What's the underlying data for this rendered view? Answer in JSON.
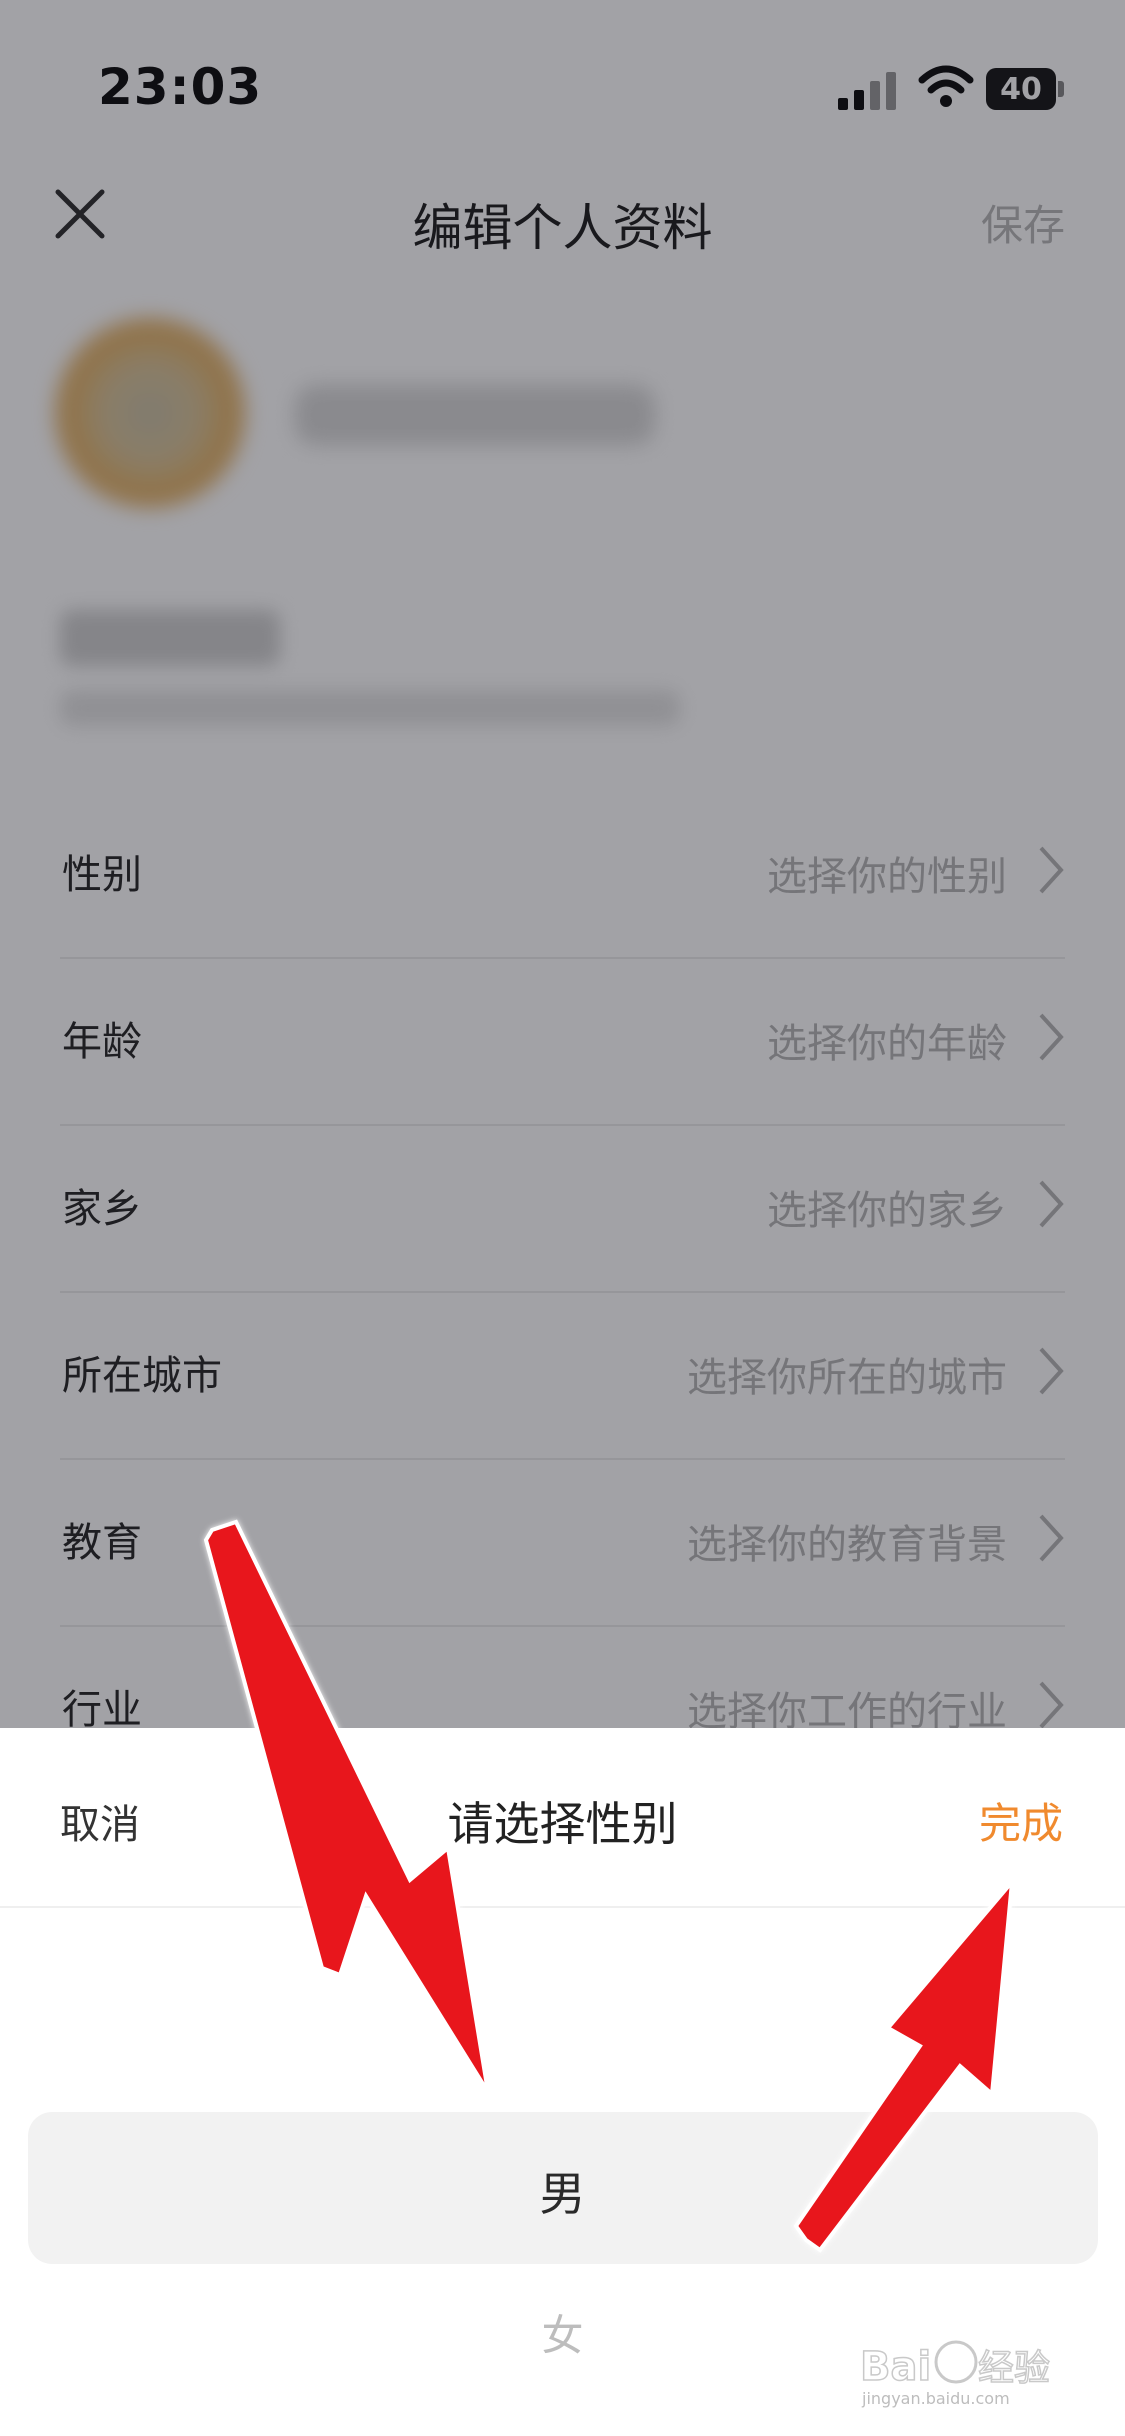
{
  "status_bar": {
    "time": "23:03",
    "battery": "40"
  },
  "nav": {
    "title": "编辑个人资料",
    "save_label": "保存"
  },
  "fields": [
    {
      "label": "性别",
      "value": "选择你的性别"
    },
    {
      "label": "年龄",
      "value": "选择你的年龄"
    },
    {
      "label": "家乡",
      "value": "选择你的家乡"
    },
    {
      "label": "所在城市",
      "value": "选择你所在的城市"
    },
    {
      "label": "教育",
      "value": "选择你的教育背景"
    },
    {
      "label": "行业",
      "value": "选择你工作的行业"
    }
  ],
  "sheet": {
    "cancel_label": "取消",
    "title": "请选择性别",
    "done_label": "完成",
    "options": [
      "男",
      "女"
    ],
    "selected": "男"
  },
  "colors": {
    "accent": "#f08a2e",
    "annotation_arrow": "#e8141b"
  },
  "watermark": "Baidu 经验 jingyan.baidu.com"
}
